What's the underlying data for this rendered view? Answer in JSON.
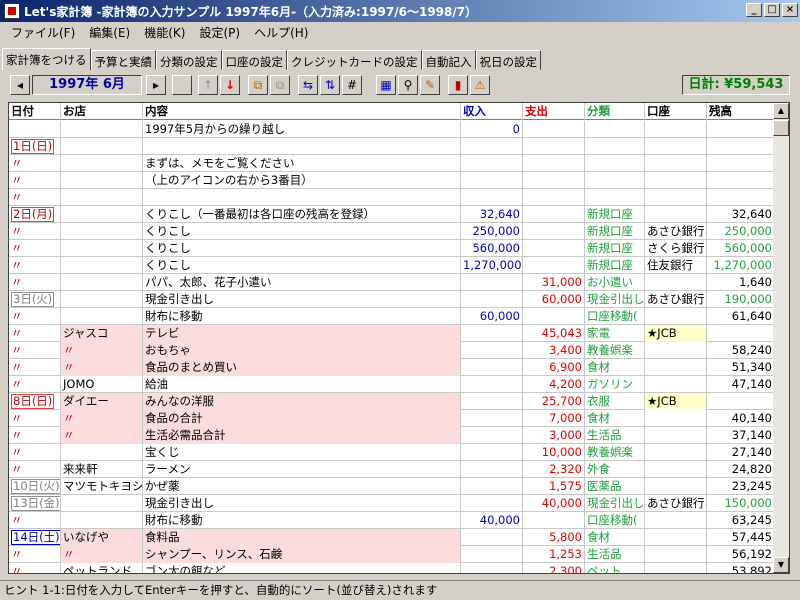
{
  "window": {
    "title": "Let's家計簿 -家計簿の入力サンプル 1997年6月-（入力済み:1997/6～1998/7）",
    "minimize": "_",
    "maximize": "□",
    "close": "×"
  },
  "menu": [
    "ファイル(F)",
    "編集(E)",
    "機能(K)",
    "設定(P)",
    "ヘルプ(H)"
  ],
  "tabs": [
    "家計簿をつける",
    "予算と実績",
    "分類の設定",
    "口座の設定",
    "クレジットカードの設定",
    "自動記入",
    "祝日の設定"
  ],
  "toolbar": {
    "month": "1997年 6月",
    "daily_total": "日計: ¥59,543"
  },
  "columns": {
    "date": "日付",
    "shop": "お店",
    "item": "内容",
    "income": "収入",
    "expense": "支出",
    "category": "分類",
    "account": "口座",
    "balance": "残高"
  },
  "rows": [
    {
      "date": "",
      "shop": "",
      "item": "1997年5月からの繰り越し",
      "income": "0",
      "expense": "",
      "category": "",
      "account": "",
      "balance": ""
    },
    {
      "date": "1日(日)",
      "shop": "",
      "item": "",
      "income": "",
      "expense": "",
      "category": "",
      "account": "",
      "balance": ""
    },
    {
      "date": "〃",
      "shop": "",
      "item": "まずは、メモをご覧ください",
      "income": "",
      "expense": "",
      "category": "",
      "account": "",
      "balance": ""
    },
    {
      "date": "〃",
      "shop": "",
      "item": "（上のアイコンの右から3番目）",
      "income": "",
      "expense": "",
      "category": "",
      "account": "",
      "balance": ""
    },
    {
      "date": "〃",
      "shop": "",
      "item": "",
      "income": "",
      "expense": "",
      "category": "",
      "account": "",
      "balance": ""
    },
    {
      "date": "2日(月)",
      "shop": "",
      "item": "くりこし（一番最初は各口座の残高を登録）",
      "income": "32,640",
      "expense": "",
      "category": "新規口座",
      "account": "",
      "balance": "32,640"
    },
    {
      "date": "〃",
      "shop": "",
      "item": "くりこし",
      "income": "250,000",
      "expense": "",
      "category": "新規口座",
      "account": "あさひ銀行",
      "balance": "250,000"
    },
    {
      "date": "〃",
      "shop": "",
      "item": "くりこし",
      "income": "560,000",
      "expense": "",
      "category": "新規口座",
      "account": "さくら銀行",
      "balance": "560,000"
    },
    {
      "date": "〃",
      "shop": "",
      "item": "くりこし",
      "income": "1,270,000",
      "expense": "",
      "category": "新規口座",
      "account": "住友銀行",
      "balance": "1,270,000"
    },
    {
      "date": "〃",
      "shop": "",
      "item": "パパ、太郎、花子小遣い",
      "income": "",
      "expense": "31,000",
      "category": "お小遣い",
      "account": "",
      "balance": "1,640"
    },
    {
      "date": "3日(火)",
      "shop": "",
      "item": "現金引き出し",
      "income": "",
      "expense": "60,000",
      "category": "現金引出し",
      "account": "あさひ銀行",
      "balance": "190,000"
    },
    {
      "date": "〃",
      "shop": "",
      "item": "財布に移動",
      "income": "60,000",
      "expense": "",
      "category": "口座移動(",
      "account": "",
      "balance": "61,640"
    },
    {
      "date": "〃",
      "shop": "ジャスコ",
      "item": "テレビ",
      "income": "",
      "expense": "45,043",
      "category": "家電",
      "account": "★JCB",
      "balance": ""
    },
    {
      "date": "〃",
      "shop": "〃",
      "item": "おもちゃ",
      "income": "",
      "expense": "3,400",
      "category": "教養娯楽",
      "account": "",
      "balance": "58,240"
    },
    {
      "date": "〃",
      "shop": "〃",
      "item": "食品のまとめ買い",
      "income": "",
      "expense": "6,900",
      "category": "食材",
      "account": "",
      "balance": "51,340"
    },
    {
      "date": "〃",
      "shop": "JOMO",
      "item": "給油",
      "income": "",
      "expense": "4,200",
      "category": "ガソリン",
      "account": "",
      "balance": "47,140"
    },
    {
      "date": "8日(日)",
      "shop": "ダイエー",
      "item": "みんなの洋服",
      "income": "",
      "expense": "25,700",
      "category": "衣服",
      "account": "★JCB",
      "balance": ""
    },
    {
      "date": "〃",
      "shop": "〃",
      "item": "食品の合計",
      "income": "",
      "expense": "7,000",
      "category": "食材",
      "account": "",
      "balance": "40,140"
    },
    {
      "date": "〃",
      "shop": "〃",
      "item": "生活必需品合計",
      "income": "",
      "expense": "3,000",
      "category": "生活品",
      "account": "",
      "balance": "37,140"
    },
    {
      "date": "〃",
      "shop": "",
      "item": "宝くじ",
      "income": "",
      "expense": "10,000",
      "category": "教養娯楽",
      "account": "",
      "balance": "27,140"
    },
    {
      "date": "〃",
      "shop": "来来軒",
      "item": "ラーメン",
      "income": "",
      "expense": "2,320",
      "category": "外食",
      "account": "",
      "balance": "24,820"
    },
    {
      "date": "10日(火)",
      "shop": "マツモトキヨシ",
      "item": "かぜ薬",
      "income": "",
      "expense": "1,575",
      "category": "医薬品",
      "account": "",
      "balance": "23,245"
    },
    {
      "date": "13日(金)",
      "shop": "",
      "item": "現金引き出し",
      "income": "",
      "expense": "40,000",
      "category": "現金引出し",
      "account": "あさひ銀行",
      "balance": "150,000"
    },
    {
      "date": "〃",
      "shop": "",
      "item": "財布に移動",
      "income": "40,000",
      "expense": "",
      "category": "口座移動(",
      "account": "",
      "balance": "63,245"
    },
    {
      "date": "14日(土)",
      "shop": "いなげや",
      "item": "食料品",
      "income": "",
      "expense": "5,800",
      "category": "食材",
      "account": "",
      "balance": "57,445"
    },
    {
      "date": "〃",
      "shop": "〃",
      "item": "シャンプー、リンス、石鹸",
      "income": "",
      "expense": "1,253",
      "category": "生活品",
      "account": "",
      "balance": "56,192"
    },
    {
      "date": "〃",
      "shop": "ペットランド",
      "item": "ゴン太の餌など",
      "income": "",
      "expense": "2,300",
      "category": "ペット",
      "account": "",
      "balance": "53,892"
    }
  ],
  "status": "ヒント 1-1:日付を入力してEnterキーを押すと、自動的にソート(並び替え)されます"
}
